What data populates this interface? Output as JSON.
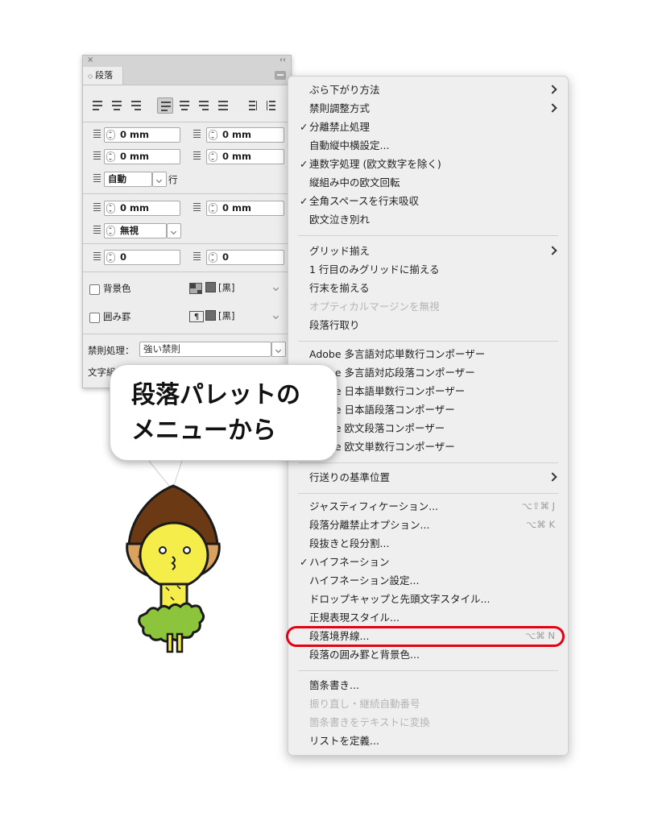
{
  "panel": {
    "close_glyph": "×",
    "collapse_glyph": "‹‹",
    "tab_label": "段落",
    "left_indent": "0 mm",
    "right_indent": "0 mm",
    "first_line_indent": "0 mm",
    "last_line_indent": "0 mm",
    "auto_leading": "自動",
    "auto_leading_unit": "行",
    "space_before": "0 mm",
    "space_after": "0 mm",
    "align_to_grid": "無視",
    "drop_cap_lines": "0",
    "drop_cap_chars": "0",
    "shading_label": "背景色",
    "shading_color": "[黒]",
    "border_label": "囲み罫",
    "border_color": "[黒]",
    "kinsoku_label": "禁則処理：",
    "kinsoku_value": "強い禁則",
    "mojikumi_label": "文字組"
  },
  "menu": {
    "items": [
      {
        "label": "ぶら下がり方法",
        "submenu": true
      },
      {
        "label": "禁則調整方式",
        "submenu": true
      },
      {
        "label": "分離禁止処理",
        "checked": true
      },
      {
        "label": "自動縦中横設定..."
      },
      {
        "label": "連数字処理 (欧文数字を除く)",
        "checked": true
      },
      {
        "label": "縦組み中の欧文回転"
      },
      {
        "label": "全角スペースを行末吸収",
        "checked": true
      },
      {
        "label": "欧文泣き別れ"
      },
      {
        "label": "グリッド揃え",
        "submenu": true
      },
      {
        "label": "1 行目のみグリッドに揃える"
      },
      {
        "label": "行末を揃える"
      },
      {
        "label": "オプティカルマージンを無視",
        "disabled": true
      },
      {
        "label": "段落行取り"
      },
      {
        "label": "Adobe 多言語対応単数行コンポーザー"
      },
      {
        "label": "Adobe 多言語対応段落コンポーザー"
      },
      {
        "label": "Adobe 日本語単数行コンポーザー"
      },
      {
        "label": "Adobe 日本語段落コンポーザー"
      },
      {
        "label": "Adobe 欧文段落コンポーザー"
      },
      {
        "label": "Adobe 欧文単数行コンポーザー"
      },
      {
        "label": "行送りの基準位置",
        "submenu": true
      },
      {
        "label": "ジャスティフィケーション...",
        "shortcut": "⌥⇧⌘ J"
      },
      {
        "label": "段落分離禁止オプション...",
        "shortcut": "⌥⌘ K"
      },
      {
        "label": "段抜きと段分割..."
      },
      {
        "label": "ハイフネーション",
        "checked": true
      },
      {
        "label": "ハイフネーション設定..."
      },
      {
        "label": "ドロップキャップと先頭文字スタイル..."
      },
      {
        "label": "正規表現スタイル..."
      },
      {
        "label": "段落境界線...",
        "shortcut": "⌥⌘ N",
        "highlighted": true
      },
      {
        "label": "段落の囲み罫と背景色..."
      },
      {
        "label": "箇条書き..."
      },
      {
        "label": "振り直し・継続自動番号",
        "disabled": true
      },
      {
        "label": "箇条書きをテキストに変換",
        "disabled": true
      },
      {
        "label": "リストを定義..."
      }
    ]
  },
  "callout": {
    "line1": "段落パレットの",
    "line2": "メニューから"
  },
  "colors": {
    "highlight": "#e60012",
    "mascot_face": "#f5ee4a",
    "mascot_cap": "#6b3a14",
    "mascot_skirt": "#8cc43c"
  }
}
